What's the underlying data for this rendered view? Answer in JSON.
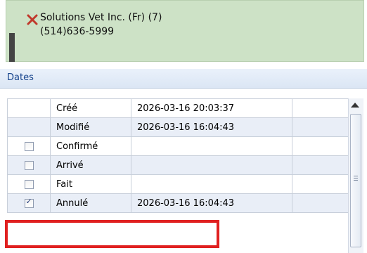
{
  "appointment": {
    "client_line": "Solutions Vet Inc. (Fr) (7)",
    "phone_line": "(514)636-5999",
    "close_color": "#c0392b"
  },
  "dates_panel": {
    "title": "Dates",
    "rows": [
      {
        "has_checkbox": false,
        "checked": false,
        "label": "Créé",
        "date": "2026-03-16 20:03:37"
      },
      {
        "has_checkbox": false,
        "checked": false,
        "label": "Modifié",
        "date": "2026-03-16 16:04:43"
      },
      {
        "has_checkbox": true,
        "checked": false,
        "label": "Confirmé",
        "date": ""
      },
      {
        "has_checkbox": true,
        "checked": false,
        "label": "Arrivé",
        "date": ""
      },
      {
        "has_checkbox": true,
        "checked": false,
        "label": "Fait",
        "date": ""
      },
      {
        "has_checkbox": true,
        "checked": true,
        "label": "Annulé",
        "date": "2026-03-16 16:04:43"
      }
    ],
    "highlight_color": "#e02020"
  }
}
